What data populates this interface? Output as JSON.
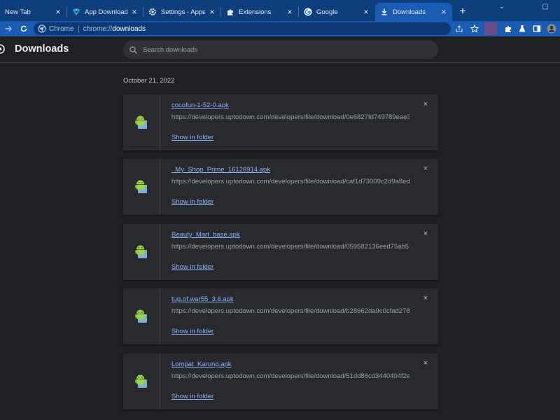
{
  "tabs": [
    {
      "title": "New Tab",
      "favicon": "none",
      "active": false
    },
    {
      "title": "App Downloads for",
      "favicon": "uptodown-icon",
      "active": false
    },
    {
      "title": "Settings - Appearan",
      "favicon": "gear-icon",
      "active": false
    },
    {
      "title": "Extensions",
      "favicon": "puzzle-icon",
      "active": false
    },
    {
      "title": "Google",
      "favicon": "google-icon",
      "active": false
    },
    {
      "title": "Downloads",
      "favicon": "download-icon",
      "active": true
    }
  ],
  "tab_close_glyph": "×",
  "new_tab_glyph": "+",
  "window_controls": {
    "minimize": "⌄",
    "restore": "▢"
  },
  "omnibox": {
    "label": "Chrome",
    "url_scheme": "chrome://",
    "url_host": "downloads"
  },
  "colors": {
    "tabstrip": "#0c3f7c",
    "toolbar": "#1a5cb4",
    "page_bg": "#202124",
    "card_bg": "#292a2d",
    "link": "#8ab4f8",
    "muted": "#9aa0a6"
  },
  "page": {
    "title": "Downloads",
    "search_placeholder": "Search downloads"
  },
  "date_heading": "October 21, 2022",
  "downloads": [
    {
      "name": "cocofun-1-52-0.apk",
      "url": "https://developers.uptodown.com/developers/file/download/0e6827fd749789eae35...",
      "action": "Show in folder"
    },
    {
      "name": "_My_Shop_Prime_16126914.apk",
      "url": "https://developers.uptodown.com/developers/file/download/caf1d73009c2d9a8ed5...",
      "action": "Show in folder"
    },
    {
      "name": "Beauty_Mart_base.apk",
      "url": "https://developers.uptodown.com/developers/file/download/059582136eed75ab57...",
      "action": "Show in folder"
    },
    {
      "name": "tug.of.war55_3.6.apk",
      "url": "https://developers.uptodown.com/developers/file/download/b28662da9c0cfad2788...",
      "action": "Show in folder"
    },
    {
      "name": "Lompat_Karung.apk",
      "url": "https://developers.uptodown.com/developers/file/download/51dd86cd3440404f2eb...",
      "action": "Show in folder"
    }
  ],
  "remove_glyph": "×"
}
